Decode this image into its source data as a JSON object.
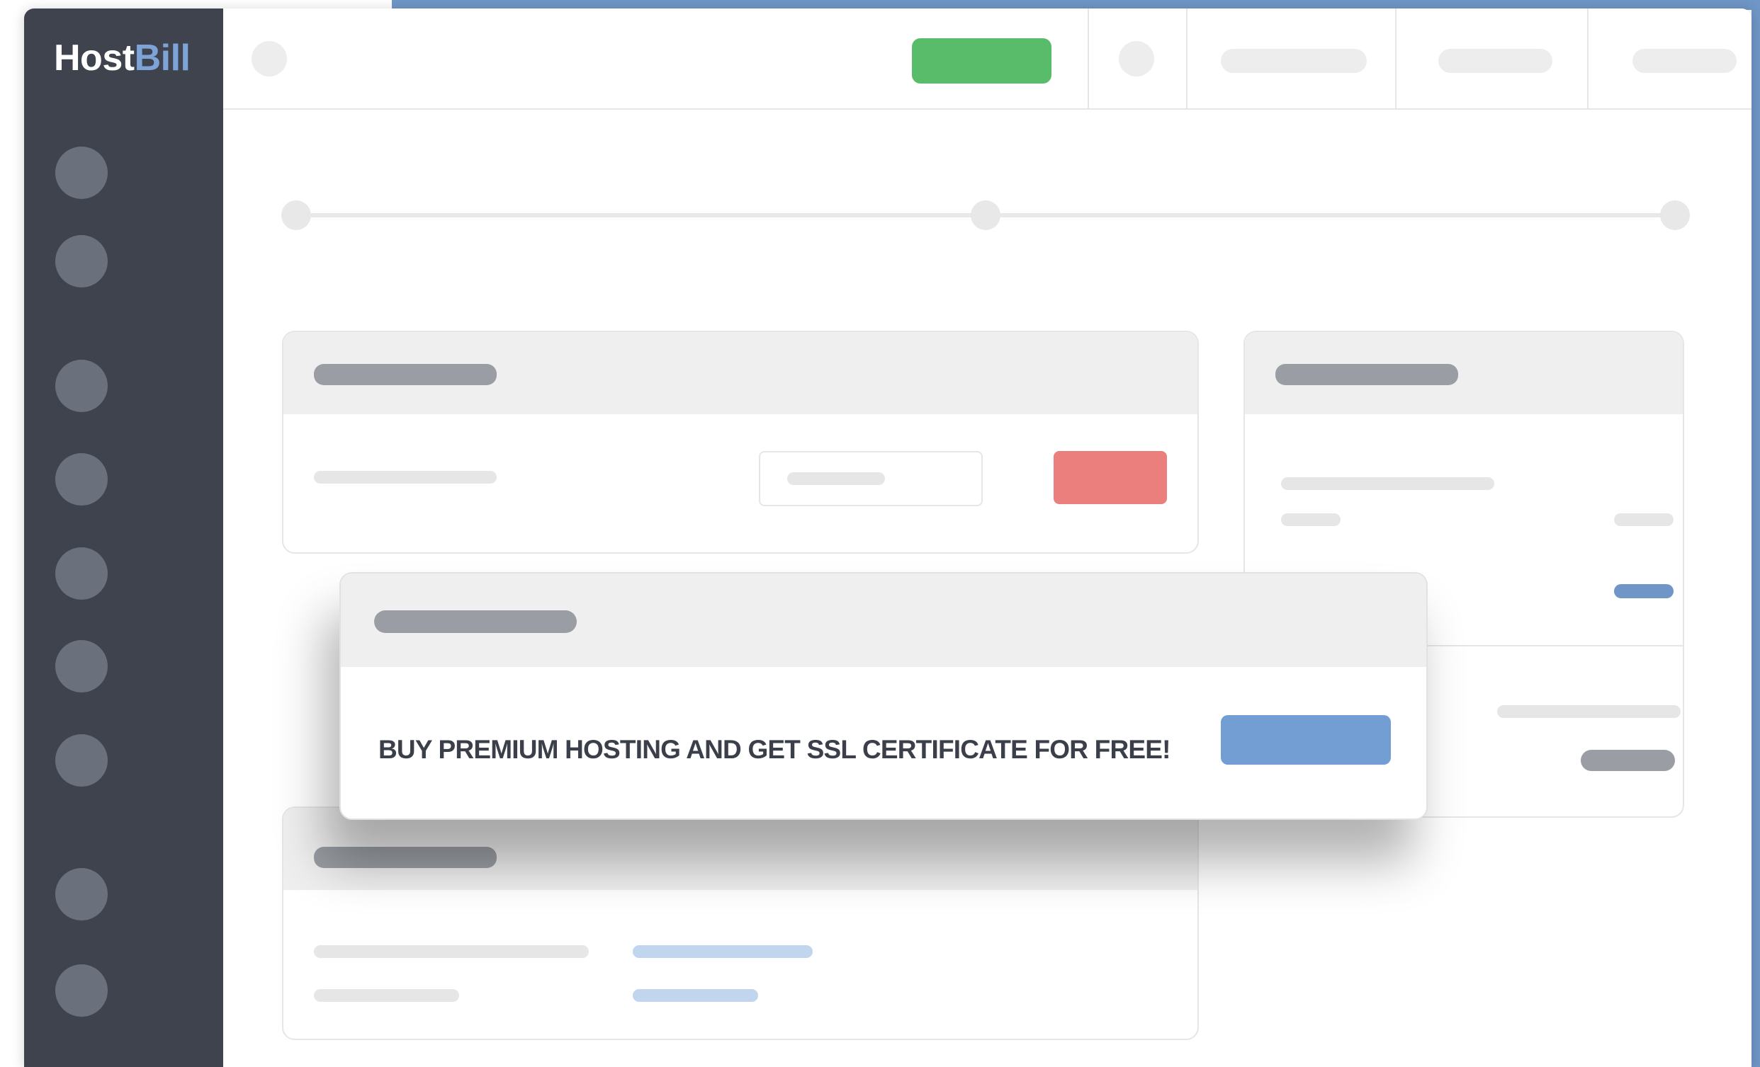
{
  "brand": {
    "logo_part1": "Host",
    "logo_part2": "Bill"
  },
  "promo": {
    "text": "BUY PREMIUM HOSTING AND GET SSL CERTIFICATE FOR FREE!"
  },
  "colors": {
    "sidebar": "#3e434d",
    "accent_blue": "#6f96c6",
    "green_button": "#58bc6a",
    "red_button": "#eb7f7e",
    "promo_button": "#739ed4"
  },
  "sidebar": {
    "items": [
      {
        "icon": "nav-icon-1"
      },
      {
        "icon": "nav-icon-2"
      },
      {
        "icon": "nav-icon-3"
      },
      {
        "icon": "nav-icon-4"
      },
      {
        "icon": "nav-icon-5"
      },
      {
        "icon": "nav-icon-6"
      },
      {
        "icon": "nav-icon-7"
      },
      {
        "icon": "nav-icon-8"
      },
      {
        "icon": "nav-icon-9"
      }
    ]
  }
}
